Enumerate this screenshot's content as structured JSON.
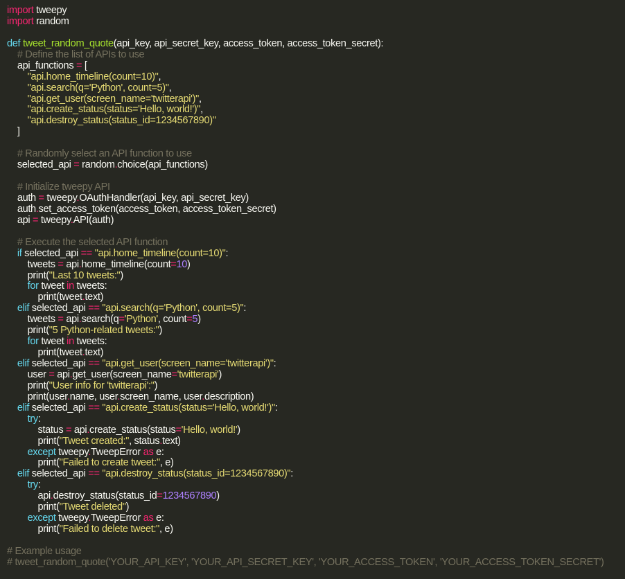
{
  "editor": {
    "theme": {
      "background": "#272822",
      "plain": "#f8f8f2",
      "keyword": "#f92672",
      "storage": "#66d9ef",
      "function": "#a6e22e",
      "string": "#e6db74",
      "number": "#ae81ff",
      "comment": "#75715e"
    },
    "lines": [
      [
        [
          "kw",
          "import"
        ],
        [
          "pl",
          " tweepy"
        ]
      ],
      [
        [
          "kw",
          "import"
        ],
        [
          "pl",
          " random"
        ]
      ],
      [],
      [
        [
          "def",
          "def"
        ],
        [
          "pl",
          " "
        ],
        [
          "fn",
          "tweet_random_quote"
        ],
        [
          "pl",
          "(api_key, api_secret_key, access_token, access_token_secret):"
        ]
      ],
      [
        [
          "pl",
          "    "
        ],
        [
          "cm",
          "# Define the list of APIs to use"
        ]
      ],
      [
        [
          "pl",
          "    api_functions "
        ],
        [
          "kw",
          "="
        ],
        [
          "pl",
          " ["
        ]
      ],
      [
        [
          "pl",
          "        "
        ],
        [
          "str",
          "\"api.home_timeline(count=10)\""
        ],
        [
          "pl",
          ","
        ]
      ],
      [
        [
          "pl",
          "        "
        ],
        [
          "str",
          "\"api.search(q='Python', count=5)\""
        ],
        [
          "pl",
          ","
        ]
      ],
      [
        [
          "pl",
          "        "
        ],
        [
          "str",
          "\"api.get_user(screen_name='twitterapi')\""
        ],
        [
          "pl",
          ","
        ]
      ],
      [
        [
          "pl",
          "        "
        ],
        [
          "str",
          "\"api.create_status(status='Hello, world!')\""
        ],
        [
          "pl",
          ","
        ]
      ],
      [
        [
          "pl",
          "        "
        ],
        [
          "str",
          "\"api.destroy_status(status_id=1234567890)\""
        ]
      ],
      [
        [
          "pl",
          "    ]"
        ]
      ],
      [],
      [
        [
          "pl",
          "    "
        ],
        [
          "cm",
          "# Randomly select an API function to use"
        ]
      ],
      [
        [
          "pl",
          "    selected_api "
        ],
        [
          "kw",
          "="
        ],
        [
          "pl",
          " random"
        ],
        [
          "kw",
          "."
        ],
        [
          "pl",
          "choice(api_functions)"
        ]
      ],
      [],
      [
        [
          "pl",
          "    "
        ],
        [
          "cm",
          "# Initialize tweepy API"
        ]
      ],
      [
        [
          "pl",
          "    auth "
        ],
        [
          "kw",
          "="
        ],
        [
          "pl",
          " tweepy"
        ],
        [
          "kw",
          "."
        ],
        [
          "pl",
          "OAuthHandler(api_key, api_secret_key)"
        ]
      ],
      [
        [
          "pl",
          "    auth"
        ],
        [
          "kw",
          "."
        ],
        [
          "pl",
          "set_access_token(access_token, access_token_secret)"
        ]
      ],
      [
        [
          "pl",
          "    api "
        ],
        [
          "kw",
          "="
        ],
        [
          "pl",
          " tweepy"
        ],
        [
          "kw",
          "."
        ],
        [
          "pl",
          "API(auth)"
        ]
      ],
      [],
      [
        [
          "pl",
          "    "
        ],
        [
          "cm",
          "# Execute the selected API function"
        ]
      ],
      [
        [
          "pl",
          "    "
        ],
        [
          "def",
          "if"
        ],
        [
          "pl",
          " selected_api "
        ],
        [
          "kw",
          "=="
        ],
        [
          "pl",
          " "
        ],
        [
          "str",
          "\"api.home_timeline(count=10)\""
        ],
        [
          "pl",
          ":"
        ]
      ],
      [
        [
          "pl",
          "        tweets "
        ],
        [
          "kw",
          "="
        ],
        [
          "pl",
          " api"
        ],
        [
          "kw",
          "."
        ],
        [
          "pl",
          "home_timeline(count"
        ],
        [
          "kw",
          "="
        ],
        [
          "num",
          "10"
        ],
        [
          "pl",
          ")"
        ]
      ],
      [
        [
          "pl",
          "        print("
        ],
        [
          "str",
          "\"Last 10 tweets:\""
        ],
        [
          "pl",
          ")"
        ]
      ],
      [
        [
          "pl",
          "        "
        ],
        [
          "def",
          "for"
        ],
        [
          "pl",
          " tweet "
        ],
        [
          "kw",
          "in"
        ],
        [
          "pl",
          " tweets:"
        ]
      ],
      [
        [
          "pl",
          "            print(tweet"
        ],
        [
          "kw",
          "."
        ],
        [
          "pl",
          "text)"
        ]
      ],
      [
        [
          "pl",
          "    "
        ],
        [
          "def",
          "elif"
        ],
        [
          "pl",
          " selected_api "
        ],
        [
          "kw",
          "=="
        ],
        [
          "pl",
          " "
        ],
        [
          "str",
          "\"api.search(q='Python', count=5)\""
        ],
        [
          "pl",
          ":"
        ]
      ],
      [
        [
          "pl",
          "        tweets "
        ],
        [
          "kw",
          "="
        ],
        [
          "pl",
          " api"
        ],
        [
          "kw",
          "."
        ],
        [
          "pl",
          "search(q"
        ],
        [
          "kw",
          "="
        ],
        [
          "str",
          "'Python'"
        ],
        [
          "pl",
          ", count"
        ],
        [
          "kw",
          "="
        ],
        [
          "num",
          "5"
        ],
        [
          "pl",
          ")"
        ]
      ],
      [
        [
          "pl",
          "        print("
        ],
        [
          "str",
          "\"5 Python-related tweets:\""
        ],
        [
          "pl",
          ")"
        ]
      ],
      [
        [
          "pl",
          "        "
        ],
        [
          "def",
          "for"
        ],
        [
          "pl",
          " tweet "
        ],
        [
          "kw",
          "in"
        ],
        [
          "pl",
          " tweets:"
        ]
      ],
      [
        [
          "pl",
          "            print(tweet"
        ],
        [
          "kw",
          "."
        ],
        [
          "pl",
          "text)"
        ]
      ],
      [
        [
          "pl",
          "    "
        ],
        [
          "def",
          "elif"
        ],
        [
          "pl",
          " selected_api "
        ],
        [
          "kw",
          "=="
        ],
        [
          "pl",
          " "
        ],
        [
          "str",
          "\"api.get_user(screen_name='twitterapi')\""
        ],
        [
          "pl",
          ":"
        ]
      ],
      [
        [
          "pl",
          "        user "
        ],
        [
          "kw",
          "="
        ],
        [
          "pl",
          " api"
        ],
        [
          "kw",
          "."
        ],
        [
          "pl",
          "get_user(screen_name"
        ],
        [
          "kw",
          "="
        ],
        [
          "str",
          "'twitterapi'"
        ],
        [
          "pl",
          ")"
        ]
      ],
      [
        [
          "pl",
          "        print("
        ],
        [
          "str",
          "\"User info for 'twitterapi':\""
        ],
        [
          "pl",
          ")"
        ]
      ],
      [
        [
          "pl",
          "        print(user"
        ],
        [
          "kw",
          "."
        ],
        [
          "pl",
          "name, user"
        ],
        [
          "kw",
          "."
        ],
        [
          "pl",
          "screen_name, user"
        ],
        [
          "kw",
          "."
        ],
        [
          "pl",
          "description)"
        ]
      ],
      [
        [
          "pl",
          "    "
        ],
        [
          "def",
          "elif"
        ],
        [
          "pl",
          " selected_api "
        ],
        [
          "kw",
          "=="
        ],
        [
          "pl",
          " "
        ],
        [
          "str",
          "\"api.create_status(status='Hello, world!')\""
        ],
        [
          "pl",
          ":"
        ]
      ],
      [
        [
          "pl",
          "        "
        ],
        [
          "def",
          "try"
        ],
        [
          "pl",
          ":"
        ]
      ],
      [
        [
          "pl",
          "            status "
        ],
        [
          "kw",
          "="
        ],
        [
          "pl",
          " api"
        ],
        [
          "kw",
          "."
        ],
        [
          "pl",
          "create_status(status"
        ],
        [
          "kw",
          "="
        ],
        [
          "str",
          "'Hello, world!'"
        ],
        [
          "pl",
          ")"
        ]
      ],
      [
        [
          "pl",
          "            print("
        ],
        [
          "str",
          "\"Tweet created:\""
        ],
        [
          "pl",
          ", status"
        ],
        [
          "kw",
          "."
        ],
        [
          "pl",
          "text)"
        ]
      ],
      [
        [
          "pl",
          "        "
        ],
        [
          "def",
          "except"
        ],
        [
          "pl",
          " tweepy"
        ],
        [
          "kw",
          "."
        ],
        [
          "pl",
          "TweepError "
        ],
        [
          "kw",
          "as"
        ],
        [
          "pl",
          " e:"
        ]
      ],
      [
        [
          "pl",
          "            print("
        ],
        [
          "str",
          "\"Failed to create tweet:\""
        ],
        [
          "pl",
          ", e)"
        ]
      ],
      [
        [
          "pl",
          "    "
        ],
        [
          "def",
          "elif"
        ],
        [
          "pl",
          " selected_api "
        ],
        [
          "kw",
          "=="
        ],
        [
          "pl",
          " "
        ],
        [
          "str",
          "\"api.destroy_status(status_id=1234567890)\""
        ],
        [
          "pl",
          ":"
        ]
      ],
      [
        [
          "pl",
          "        "
        ],
        [
          "def",
          "try"
        ],
        [
          "pl",
          ":"
        ]
      ],
      [
        [
          "pl",
          "            api"
        ],
        [
          "kw",
          "."
        ],
        [
          "pl",
          "destroy_status(status_id"
        ],
        [
          "kw",
          "="
        ],
        [
          "num",
          "1234567890"
        ],
        [
          "pl",
          ")"
        ]
      ],
      [
        [
          "pl",
          "            print("
        ],
        [
          "str",
          "\"Tweet deleted\""
        ],
        [
          "pl",
          ")"
        ]
      ],
      [
        [
          "pl",
          "        "
        ],
        [
          "def",
          "except"
        ],
        [
          "pl",
          " tweepy"
        ],
        [
          "kw",
          "."
        ],
        [
          "pl",
          "TweepError "
        ],
        [
          "kw",
          "as"
        ],
        [
          "pl",
          " e:"
        ]
      ],
      [
        [
          "pl",
          "            print("
        ],
        [
          "str",
          "\"Failed to delete tweet:\""
        ],
        [
          "pl",
          ", e)"
        ]
      ],
      [],
      [
        [
          "cm",
          "# Example usage"
        ]
      ],
      [
        [
          "cm",
          "# tweet_random_quote('YOUR_API_KEY', 'YOUR_API_SECRET_KEY', 'YOUR_ACCESS_TOKEN', 'YOUR_ACCESS_TOKEN_SECRET')"
        ]
      ]
    ]
  }
}
